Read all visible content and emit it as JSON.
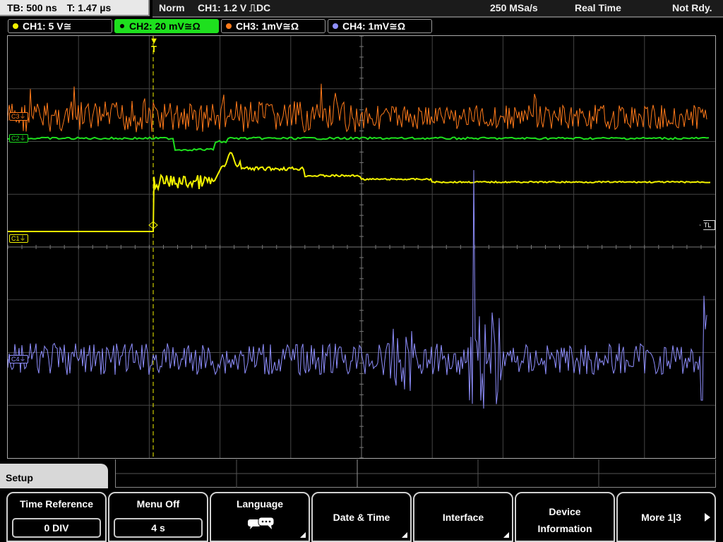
{
  "header": {
    "timebase": "TB: 500 ns",
    "trigger_time": "T: 1.47 µs",
    "mode": "Norm",
    "trigger_source": "CH1: 1.2 V ⎍DC",
    "sample_rate": "250 MSa/s",
    "acq_mode": "Real Time",
    "status": "Not Rdy."
  },
  "channels": [
    {
      "label": "CH1: 5 V≅",
      "color": "#f2f200",
      "active": false
    },
    {
      "label": "CH2: 20 mV≅Ω",
      "color": "#1ee01e",
      "active": true
    },
    {
      "label": "CH3: 1mV≅Ω",
      "color": "#ff7a1a",
      "active": false
    },
    {
      "label": "CH4: 1mV≅Ω",
      "color": "#8f8fff",
      "active": false
    }
  ],
  "trace_labels": {
    "c1": "C1",
    "c2": "C2",
    "c3": "C3",
    "c4": "C4",
    "tl": "TL"
  },
  "menu": {
    "title": "Setup",
    "softkeys": [
      {
        "label": "Time Reference",
        "value": "0 DIV"
      },
      {
        "label": "Menu Off",
        "value": "4 s"
      },
      {
        "label": "Language",
        "icon": "speech-bubbles-icon"
      },
      {
        "label": "Date & Time"
      },
      {
        "label": "Interface"
      },
      {
        "label_line1": "Device",
        "label_line2": "Information"
      },
      {
        "label": "More 1|3"
      }
    ]
  }
}
